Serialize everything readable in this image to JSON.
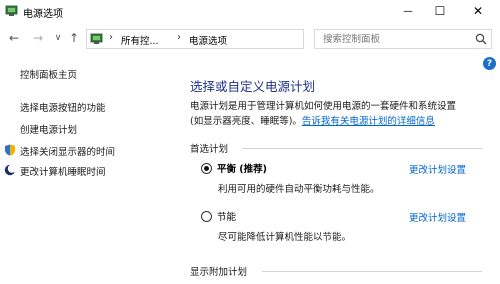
{
  "window": {
    "title": "电源选项",
    "minimize_glyph": "—",
    "maximize_glyph": "☐",
    "close_glyph": "✕"
  },
  "nav": {
    "back_glyph": "←",
    "forward_glyph": "→",
    "history_glyph": "∨",
    "up_glyph": "↑"
  },
  "address": {
    "breadcrumbs": [
      "所有控...",
      "电源选项"
    ],
    "separator": "›",
    "dropdown_glyph": "∨",
    "refresh_glyph": "↻"
  },
  "search": {
    "placeholder": "搜索控制面板"
  },
  "help_glyph": "?",
  "sidebar": {
    "items": [
      {
        "label": "控制面板主页"
      },
      {
        "label": "选择电源按钮的功能"
      },
      {
        "label": "创建电源计划"
      },
      {
        "label": "选择关闭显示器的时间",
        "icon": "shield-icon"
      },
      {
        "label": "更改计算机睡眠时间",
        "icon": "moon-icon"
      }
    ]
  },
  "main": {
    "title": "选择或自定义电源计划",
    "description_line1": "电源计划是用于管理计算机如何使用电源的一套硬件和系统设置",
    "description_line2_prefix": "(如显示器亮度、睡眠等)。",
    "description_link": "告诉我有关电源计划的详细信息",
    "preferred_section": "首选计划",
    "plans": [
      {
        "name": "平衡 (推荐)",
        "description": "利用可用的硬件自动平衡功耗与性能。",
        "change_link": "更改计划设置",
        "selected": true
      },
      {
        "name": "节能",
        "description": "尽可能降低计算机性能以节能。",
        "change_link": "更改计划设置",
        "selected": false
      }
    ],
    "additional_section": "显示附加计划"
  },
  "colors": {
    "title_blue": "#1e3287",
    "link_blue": "#0066cc",
    "help_blue": "#1c6fc9"
  }
}
